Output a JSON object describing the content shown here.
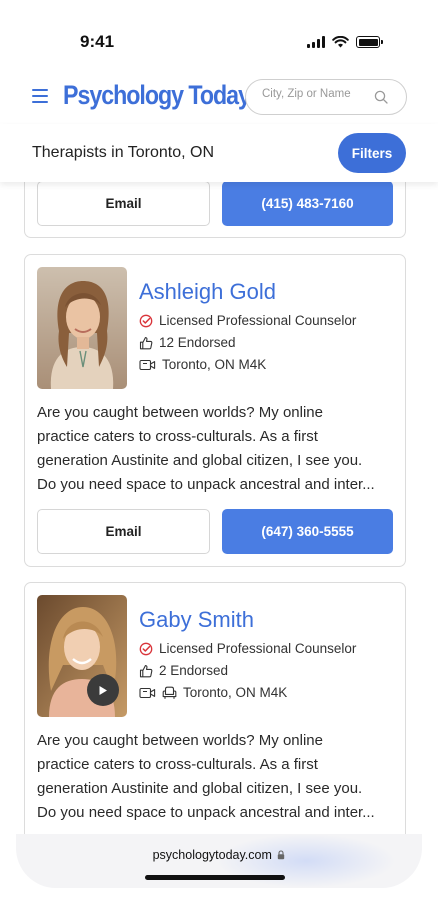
{
  "status_bar": {
    "time": "9:41"
  },
  "header": {
    "logo": "Psychology Today",
    "search_placeholder": "City, Zip or Name"
  },
  "subheader": {
    "title": "Therapists in Toronto, ON",
    "filters_label": "Filters"
  },
  "previous_card": {
    "email_label": "Email",
    "phone": "(415) 483-7160"
  },
  "therapists": [
    {
      "name": "Ashleigh Gold",
      "credential": "Licensed Professional Counselor",
      "endorsed": "12 Endorsed",
      "location": "Toronto, ON M4K",
      "bio_lines": [
        "Are you caught between worlds? My online",
        "practice caters to cross-culturals. As a first",
        "generation Austinite and global citizen, I see you.",
        "Do you need space to unpack ancestral and inter..."
      ],
      "email_label": "Email",
      "phone": "(647) 360-5555"
    },
    {
      "name": "Gaby Smith",
      "credential": "Licensed Professional Counselor",
      "endorsed": "2 Endorsed",
      "location": "Toronto, ON M4K",
      "bio_lines": [
        "Are you caught between worlds? My online",
        "practice caters to cross-culturals. As a first",
        "generation Austinite and global citizen, I see you.",
        "Do you need space to unpack ancestral and inter..."
      ]
    }
  ],
  "browser": {
    "url": "psychologytoday.com"
  },
  "colors": {
    "brand_blue": "#3d6fd8",
    "button_blue": "#4a7de3",
    "verified_red": "#d9343a"
  }
}
